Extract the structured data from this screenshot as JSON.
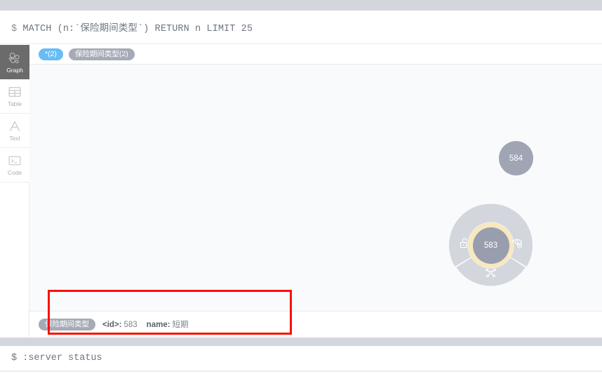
{
  "query": {
    "prompt": "$",
    "text": "MATCH (n:`保险期间类型`) RETURN n LIMIT 25"
  },
  "view_sidebar": {
    "items": [
      {
        "label": "Graph",
        "icon": "graph-icon",
        "active": true
      },
      {
        "label": "Table",
        "icon": "table-icon",
        "active": false
      },
      {
        "label": "Text",
        "icon": "text-icon",
        "active": false
      },
      {
        "label": "Code",
        "icon": "code-icon",
        "active": false
      }
    ]
  },
  "chips": [
    {
      "label": "*(2)",
      "style": "blue"
    },
    {
      "label": "保险期间类型(2)",
      "style": "grey"
    }
  ],
  "graph": {
    "nodes": [
      {
        "id": "584",
        "caption": "584",
        "selected": false
      },
      {
        "id": "583",
        "caption": "583",
        "selected": true
      }
    ],
    "radial_menu": {
      "actions": [
        {
          "name": "unlock",
          "icon": "unlock-icon"
        },
        {
          "name": "hide",
          "icon": "eye-minus-icon"
        },
        {
          "name": "expand",
          "icon": "expand-graph-icon"
        }
      ]
    }
  },
  "info_bar": {
    "label_chip": "保险期间类型",
    "properties": [
      {
        "key": "<id>:",
        "value": "583"
      },
      {
        "key": "name:",
        "value": "短期"
      }
    ]
  },
  "bottom_prompt": {
    "prompt": "$",
    "text": ":server status"
  },
  "colors": {
    "accent_blue": "#68bdf6",
    "chip_grey": "#a5abb6",
    "node_grey": "#a0a5b4",
    "selection_halo": "#f7e8bf",
    "annotation_red": "#fc1000",
    "frame_band": "#d3d7dd",
    "canvas_bg": "#f9fafc"
  }
}
